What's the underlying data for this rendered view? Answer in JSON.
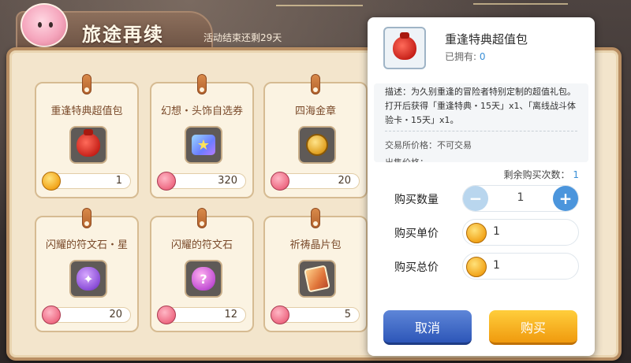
{
  "header": {
    "title": "旅途再续",
    "subtitle": "活动结束还剩29天"
  },
  "items": [
    {
      "name": "重逢特典超值包",
      "icon": "red-bag-icon",
      "currency": "gold-coin-icon",
      "price": "1"
    },
    {
      "name": "幻想・头饰自选券",
      "icon": "star-ticket-icon",
      "currency": "pink-coin-icon",
      "price": "320"
    },
    {
      "name": "四海金章",
      "icon": "gold-medal-icon",
      "currency": "pink-coin-icon",
      "price": "20"
    },
    {
      "name": "闪耀的符文石・星",
      "icon": "star-rune-icon",
      "currency": "pink-coin-icon",
      "price": "20"
    },
    {
      "name": "闪耀的符文石",
      "icon": "question-rune-icon",
      "currency": "pink-coin-icon",
      "price": "12"
    },
    {
      "name": "祈祷晶片包",
      "icon": "crystal-pack-icon",
      "currency": "pink-coin-icon",
      "price": "5"
    }
  ],
  "detail": {
    "title": "重逢特典超值包",
    "owned_label": "已拥有:",
    "owned_value": "0",
    "description": "描述：为久别重逢的冒险者特别定制的超值礼包。打开后获得「重逢特典・15天」x1、「离线战斗体验卡・15天」x1。",
    "trade_price": "交易所价格：不可交易",
    "cut_text": "出售价格：",
    "remain_label": "剩余购买次数：",
    "remain_value": "1",
    "qty_label": "购买数量",
    "qty_value": "1",
    "unit_label": "购买单价",
    "unit_value": "1",
    "total_label": "购买总价",
    "total_value": "1",
    "cancel_label": "取消",
    "buy_label": "购买"
  },
  "colors": {
    "accent_blue": "#3a8fd6",
    "cancel_button": "#2d56b8",
    "buy_button": "#f09a0e"
  }
}
